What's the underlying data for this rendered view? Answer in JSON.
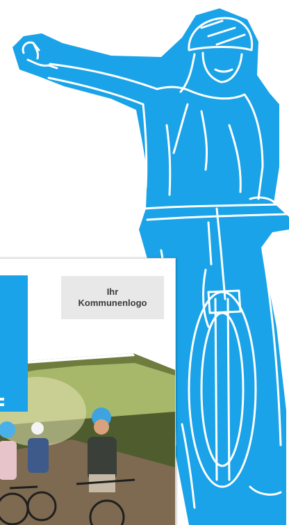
{
  "poster": {
    "logo_placeholder_line1": "Ihr",
    "logo_placeholder_line2": "Kommunenlogo"
  },
  "colors": {
    "accent_blue": "#1aa3e8",
    "line_white": "#ffffff",
    "logo_box_bg": "#e8e8e8"
  },
  "icons": {
    "cyclist_illustration": "cyclist-signalling-icon"
  }
}
